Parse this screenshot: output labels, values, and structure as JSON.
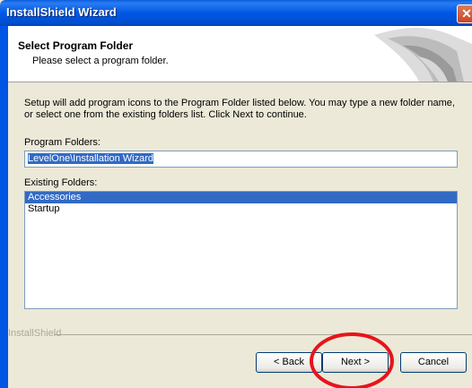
{
  "window": {
    "title": "InstallShield Wizard",
    "close_label": "✕"
  },
  "header": {
    "title": "Select Program Folder",
    "subtitle": "Please select a program folder."
  },
  "description": "Setup will add program icons to the Program Folder listed below.  You may type a new folder name, or select one from the existing folders list.  Click Next to continue.",
  "program_folders": {
    "label": "Program Folders:",
    "value": "LevelOne\\Installation Wizard"
  },
  "existing_folders": {
    "label": "Existing Folders:",
    "items": [
      "Accessories",
      "Startup"
    ],
    "selected_index": 0
  },
  "footer": {
    "brand": "InstallShield"
  },
  "buttons": {
    "back": "< Back",
    "next": "Next >",
    "cancel": "Cancel"
  },
  "colors": {
    "titlebar": "#0058e6",
    "selection": "#316ac5",
    "annotation_circle": "#e8141b"
  }
}
